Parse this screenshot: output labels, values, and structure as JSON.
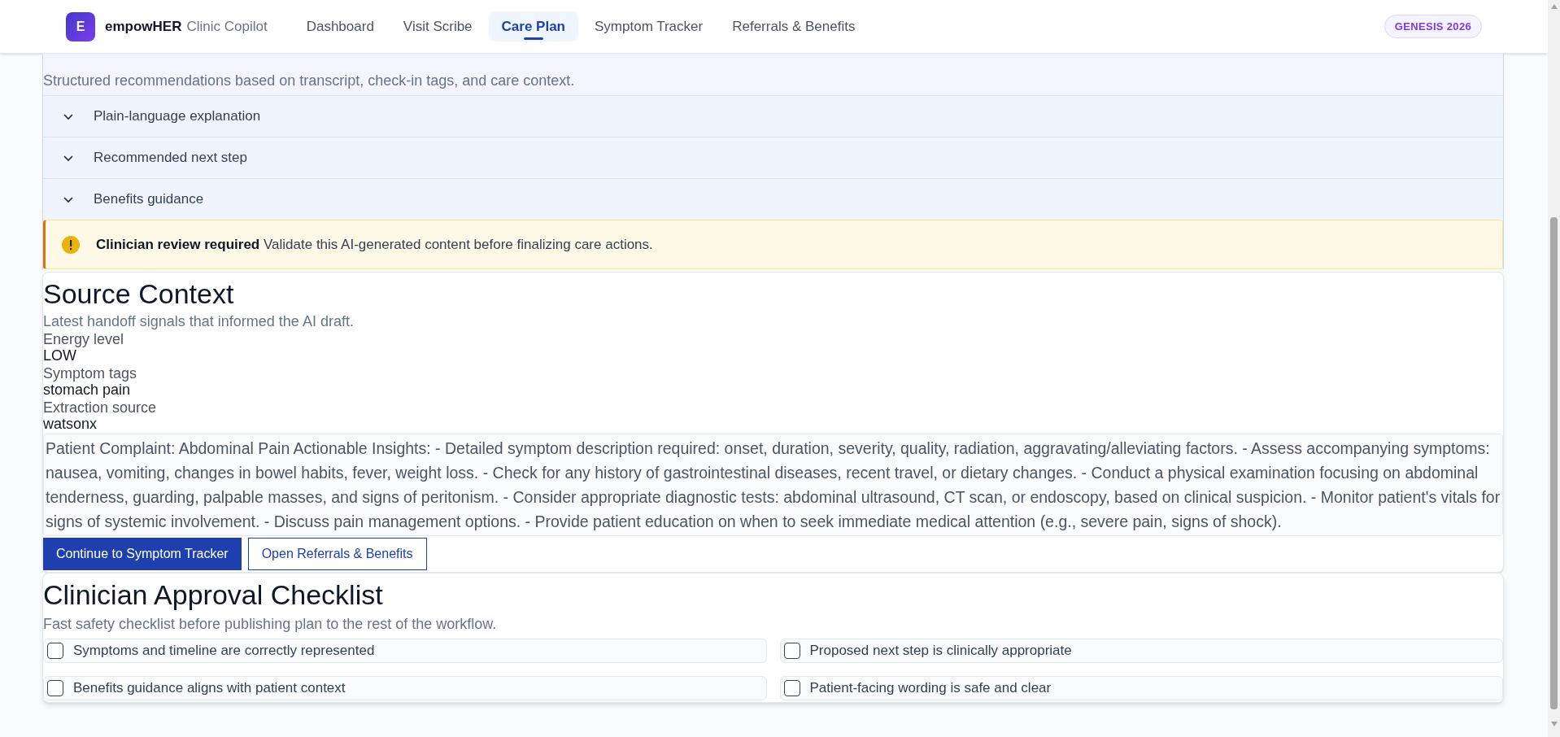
{
  "header": {
    "logo_letter": "E",
    "brand": "empowHER",
    "product": "Clinic Copilot",
    "nav": [
      {
        "label": "Dashboard",
        "selected": false
      },
      {
        "label": "Visit Scribe",
        "selected": false
      },
      {
        "label": "Care Plan",
        "selected": true
      },
      {
        "label": "Symptom Tracker",
        "selected": false
      },
      {
        "label": "Referrals & Benefits",
        "selected": false
      }
    ],
    "badge": "GENESIS 2026"
  },
  "care_plan": {
    "subtitle": "Structured recommendations based on transcript, check-in tags, and care context.",
    "sections": [
      {
        "label": "Plain-language explanation",
        "expanded": false
      },
      {
        "label": "Recommended next step",
        "expanded": false
      },
      {
        "label": "Benefits guidance",
        "expanded": false
      }
    ],
    "alert": {
      "title": "Clinician review required",
      "message": "Validate this AI-generated content before finalizing care actions."
    }
  },
  "source_context": {
    "title": "Source Context",
    "subtitle": "Latest handoff signals that informed the AI draft.",
    "fields": [
      {
        "label": "Energy level",
        "value": "LOW"
      },
      {
        "label": "Symptom tags",
        "value": "stomach pain"
      },
      {
        "label": "Extraction source",
        "value": "watsonx"
      }
    ],
    "summary": "Patient Complaint: Abdominal Pain Actionable Insights: - Detailed symptom description required: onset, duration, severity, quality, radiation, aggravating/alleviating factors. - Assess accompanying symptoms: nausea, vomiting, changes in bowel habits, fever, weight loss. - Check for any history of gastrointestinal diseases, recent travel, or dietary changes. - Conduct a physical examination focusing on abdominal tenderness, guarding, palpable masses, and signs of peritonism. - Consider appropriate diagnostic tests: abdominal ultrasound, CT scan, or endoscopy, based on clinical suspicion. - Monitor patient's vitals for signs of systemic involvement. - Discuss pain management options. - Provide patient education on when to seek immediate medical attention (e.g., severe pain, signs of shock).",
    "buttons": [
      {
        "label": "Continue to Symptom Tracker",
        "kind": "primary"
      },
      {
        "label": "Open Referrals & Benefits",
        "kind": "secondary"
      }
    ]
  },
  "checklist": {
    "title": "Clinician Approval Checklist",
    "subtitle": "Fast safety checklist before publishing plan to the rest of the workflow.",
    "items": [
      {
        "label": "Symptoms and timeline are correctly represented",
        "checked": false
      },
      {
        "label": "Proposed next step is clinically appropriate",
        "checked": false
      },
      {
        "label": "Benefits guidance aligns with patient context",
        "checked": false
      },
      {
        "label": "Patient-facing wording is safe and clear",
        "checked": false
      }
    ]
  }
}
